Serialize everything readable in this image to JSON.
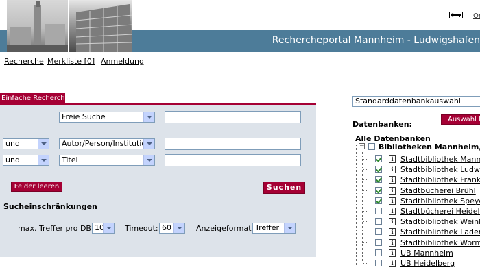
{
  "header": {
    "portal_title": "Rechercheportal Mannheim - Ludwigshafen",
    "top_link": "Or",
    "key_icon": "key-icon"
  },
  "nav": {
    "recherche": "Recherche",
    "merkliste": "Merkliste [0]",
    "anmeldung": "Anmeldung"
  },
  "search": {
    "tab_label": "Einfache Recherche",
    "rows": [
      {
        "operator": "",
        "field": "Freie Suche",
        "value": ""
      },
      {
        "operator": "und",
        "field": "Autor/Person/Institution",
        "value": ""
      },
      {
        "operator": "und",
        "field": "Titel",
        "value": ""
      }
    ],
    "clear_label": "Felder leeren",
    "search_label": "Suchen",
    "restrictions_heading": "Sucheinschränkungen",
    "max_hits_label": "max. Treffer pro DB:",
    "max_hits_value": "10",
    "timeout_label": "Timeout:",
    "timeout_value": "60",
    "format_label": "Anzeigeformat:",
    "format_value": "Treffer"
  },
  "databases": {
    "preset_select": "Standarddatenbankauswahl",
    "heading": "Datenbanken:",
    "select_button": "Auswahl lö",
    "all_label": "Alle Datenbanken",
    "group_label": "Bibliotheken Mannheim, Lud",
    "items": [
      {
        "name": "Stadtbibliothek Mannhe",
        "checked": true
      },
      {
        "name": "Stadtbibliothek Ludwigs",
        "checked": true
      },
      {
        "name": "Stadtbibliothek Franken",
        "checked": true
      },
      {
        "name": "Stadtbücherei Brühl",
        "checked": true
      },
      {
        "name": "Stadtbibliothek Speyer",
        "checked": true
      },
      {
        "name": "Stadtbücherei Heidelbe",
        "checked": false
      },
      {
        "name": "Stadtbibliothek Weinhei",
        "checked": false
      },
      {
        "name": "Stadtbibliothek Ladenbu",
        "checked": false
      },
      {
        "name": "Stadtbibliothek Worms",
        "checked": false
      },
      {
        "name": "UB Mannheim",
        "checked": false
      },
      {
        "name": "UB Heidelberg",
        "checked": false
      }
    ]
  },
  "colors": {
    "banner": "#4d7c99",
    "accent": "#a50034",
    "panel": "#dde3ea"
  }
}
